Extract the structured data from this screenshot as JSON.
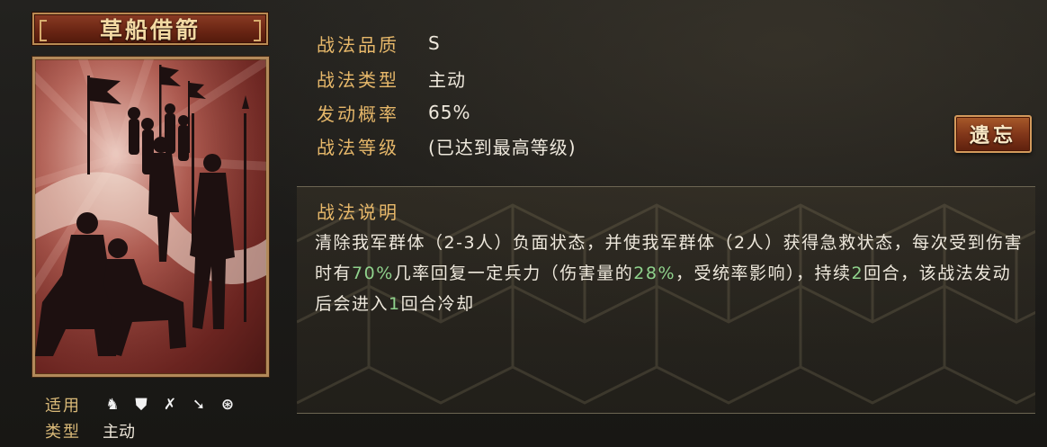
{
  "skill": {
    "name": "草船借箭",
    "apply_label": "适用",
    "type_label": "类型",
    "type_value": "主动",
    "troop_icons": [
      "cavalry-icon",
      "shield-icon",
      "bow-icon",
      "spear-icon",
      "wheel-icon"
    ]
  },
  "info": {
    "quality_label": "战法品质",
    "quality_value": "S",
    "type_label": "战法类型",
    "type_value": "主动",
    "rate_label": "发动概率",
    "rate_value": "65%",
    "level_label": "战法等级",
    "level_value": "(已达到最高等级)"
  },
  "forget_button": {
    "label": "遗忘"
  },
  "description": {
    "title": "战法说明",
    "text_1": "清除我军群体（2-3人）负面状态，并使我军群体（2人）获得急救状态，每次受到伤害时有",
    "value_1": "70%",
    "text_2": "几率回复一定兵力（伤害量的",
    "value_2": "28%",
    "text_3": "，受统率影响），持续",
    "value_3": "2",
    "text_4": "回合，该战法发动后会进入",
    "value_4": "1",
    "text_5": "回合冷却"
  },
  "colors": {
    "accent_gold": "#e7b86a",
    "highlight_green": "#8fd28c",
    "button_red": "#82371a"
  }
}
